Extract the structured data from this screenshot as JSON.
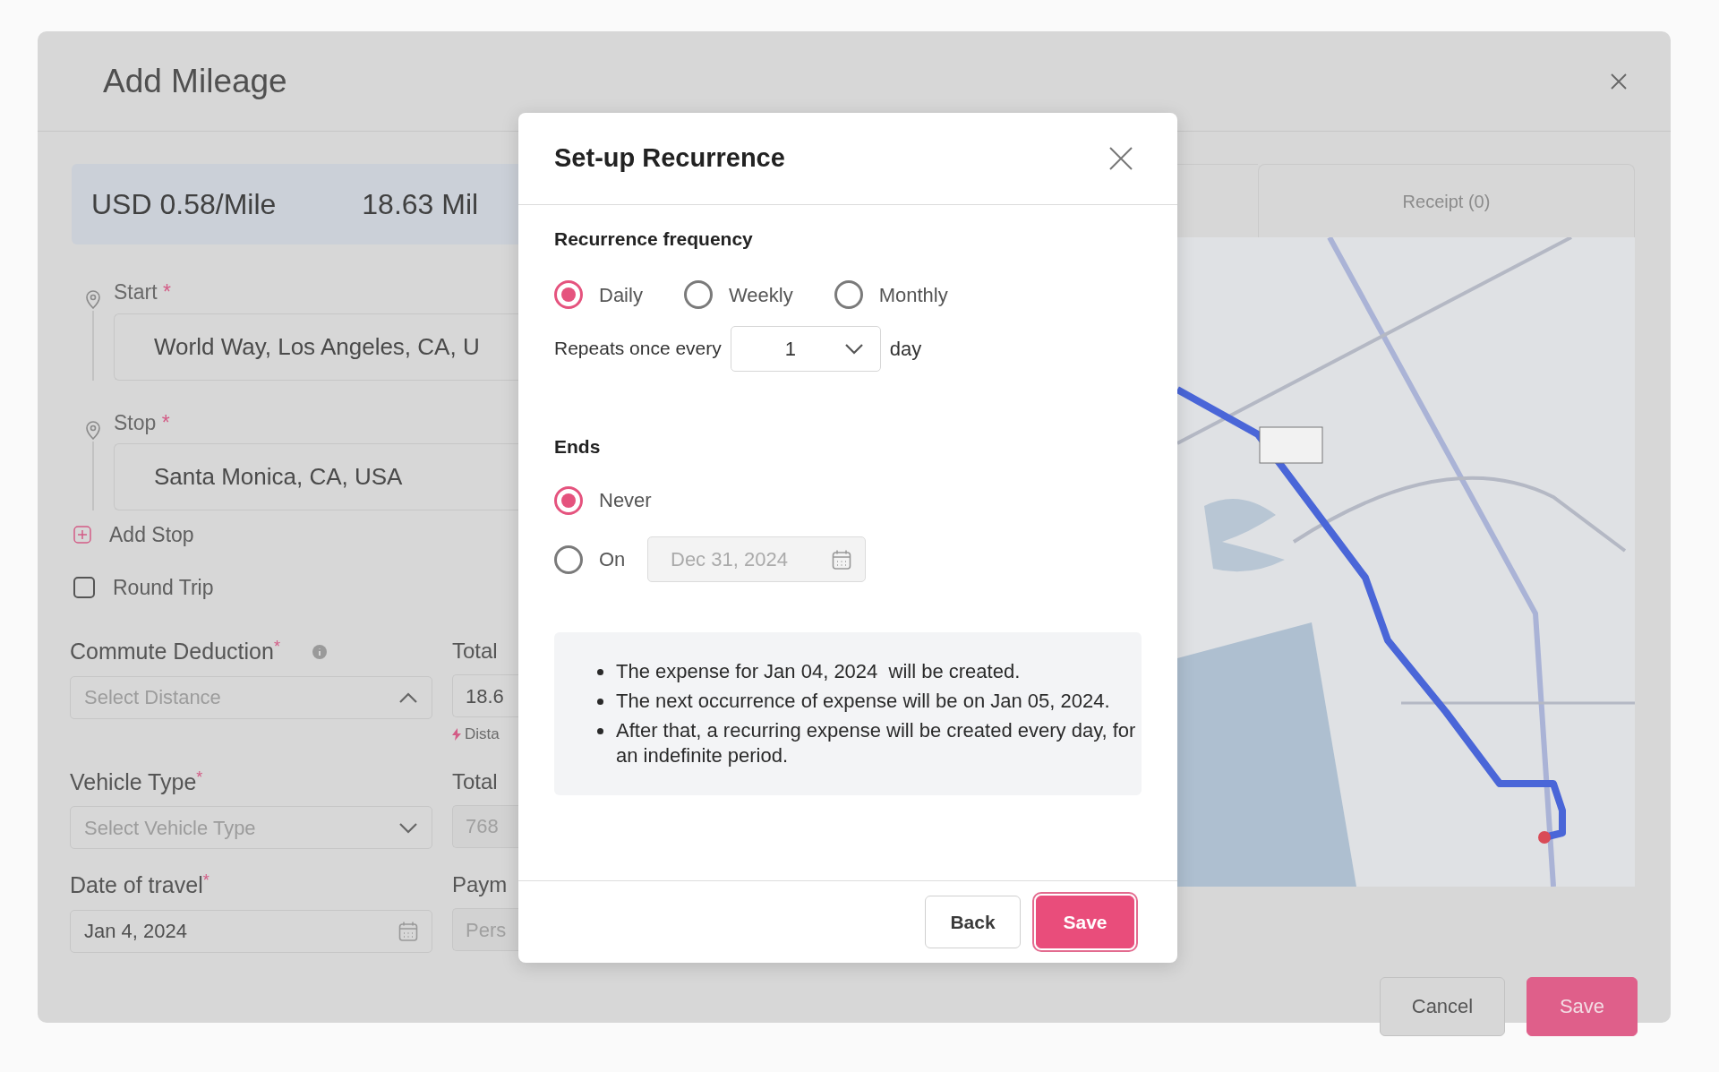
{
  "dialog": {
    "title": "Add Mileage",
    "rate": "USD 0.58/Mile",
    "distance": "18.63 Mil",
    "route": [
      {
        "label": "Start",
        "marker": "*",
        "value": "World Way, Los Angeles, CA, U"
      },
      {
        "label": "Stop",
        "marker": "*",
        "value": "Santa Monica, CA, USA"
      }
    ],
    "add_stop": "Add Stop",
    "round_trip": {
      "label": "Round Trip",
      "checked": false
    },
    "fields": [
      {
        "label": "Commute Deduction",
        "marker": "*",
        "info": true,
        "kind": "select",
        "expanded": true,
        "placeholder": "Select Distance",
        "side_label": "Total",
        "side_value": "18.6",
        "side_hint": "Dista"
      },
      {
        "label": "Vehicle Type",
        "marker": "*",
        "info": false,
        "kind": "select",
        "expanded": false,
        "placeholder": "Select Vehicle Type",
        "side_label": "Total",
        "side_value": "768"
      },
      {
        "label": "Date of travel",
        "marker": "*",
        "info": false,
        "kind": "date",
        "value": "Jan 4, 2024",
        "side_label": "Paym",
        "side_value": "Pers"
      }
    ],
    "receipt_tab": "Receipt (0)",
    "buttons": [
      {
        "label": "Cancel",
        "kind": "secondary"
      },
      {
        "label": "Save",
        "kind": "primary"
      }
    ]
  },
  "recurrence": {
    "title": "Set-up Recurrence",
    "frequency_heading": "Recurrence frequency",
    "frequency_options": [
      {
        "label": "Daily",
        "selected": true
      },
      {
        "label": "Weekly",
        "selected": false
      },
      {
        "label": "Monthly",
        "selected": false
      }
    ],
    "repeat_label": "Repeats once every",
    "repeat_value": "1",
    "repeat_unit": "day",
    "ends_heading": "Ends",
    "end_options": [
      {
        "label": "Never",
        "selected": true
      },
      {
        "label": "On",
        "selected": false,
        "date": "Dec 31, 2024",
        "disabled": true
      }
    ],
    "summary": [
      "The expense for Jan 04, 2024  will be created.",
      "The next occurrence of expense will be on Jan 05, 2024.",
      "After that, a recurring expense will be created every day, for an indefinite period."
    ],
    "buttons": [
      {
        "label": "Back",
        "kind": "secondary"
      },
      {
        "label": "Save",
        "kind": "primary"
      }
    ]
  }
}
